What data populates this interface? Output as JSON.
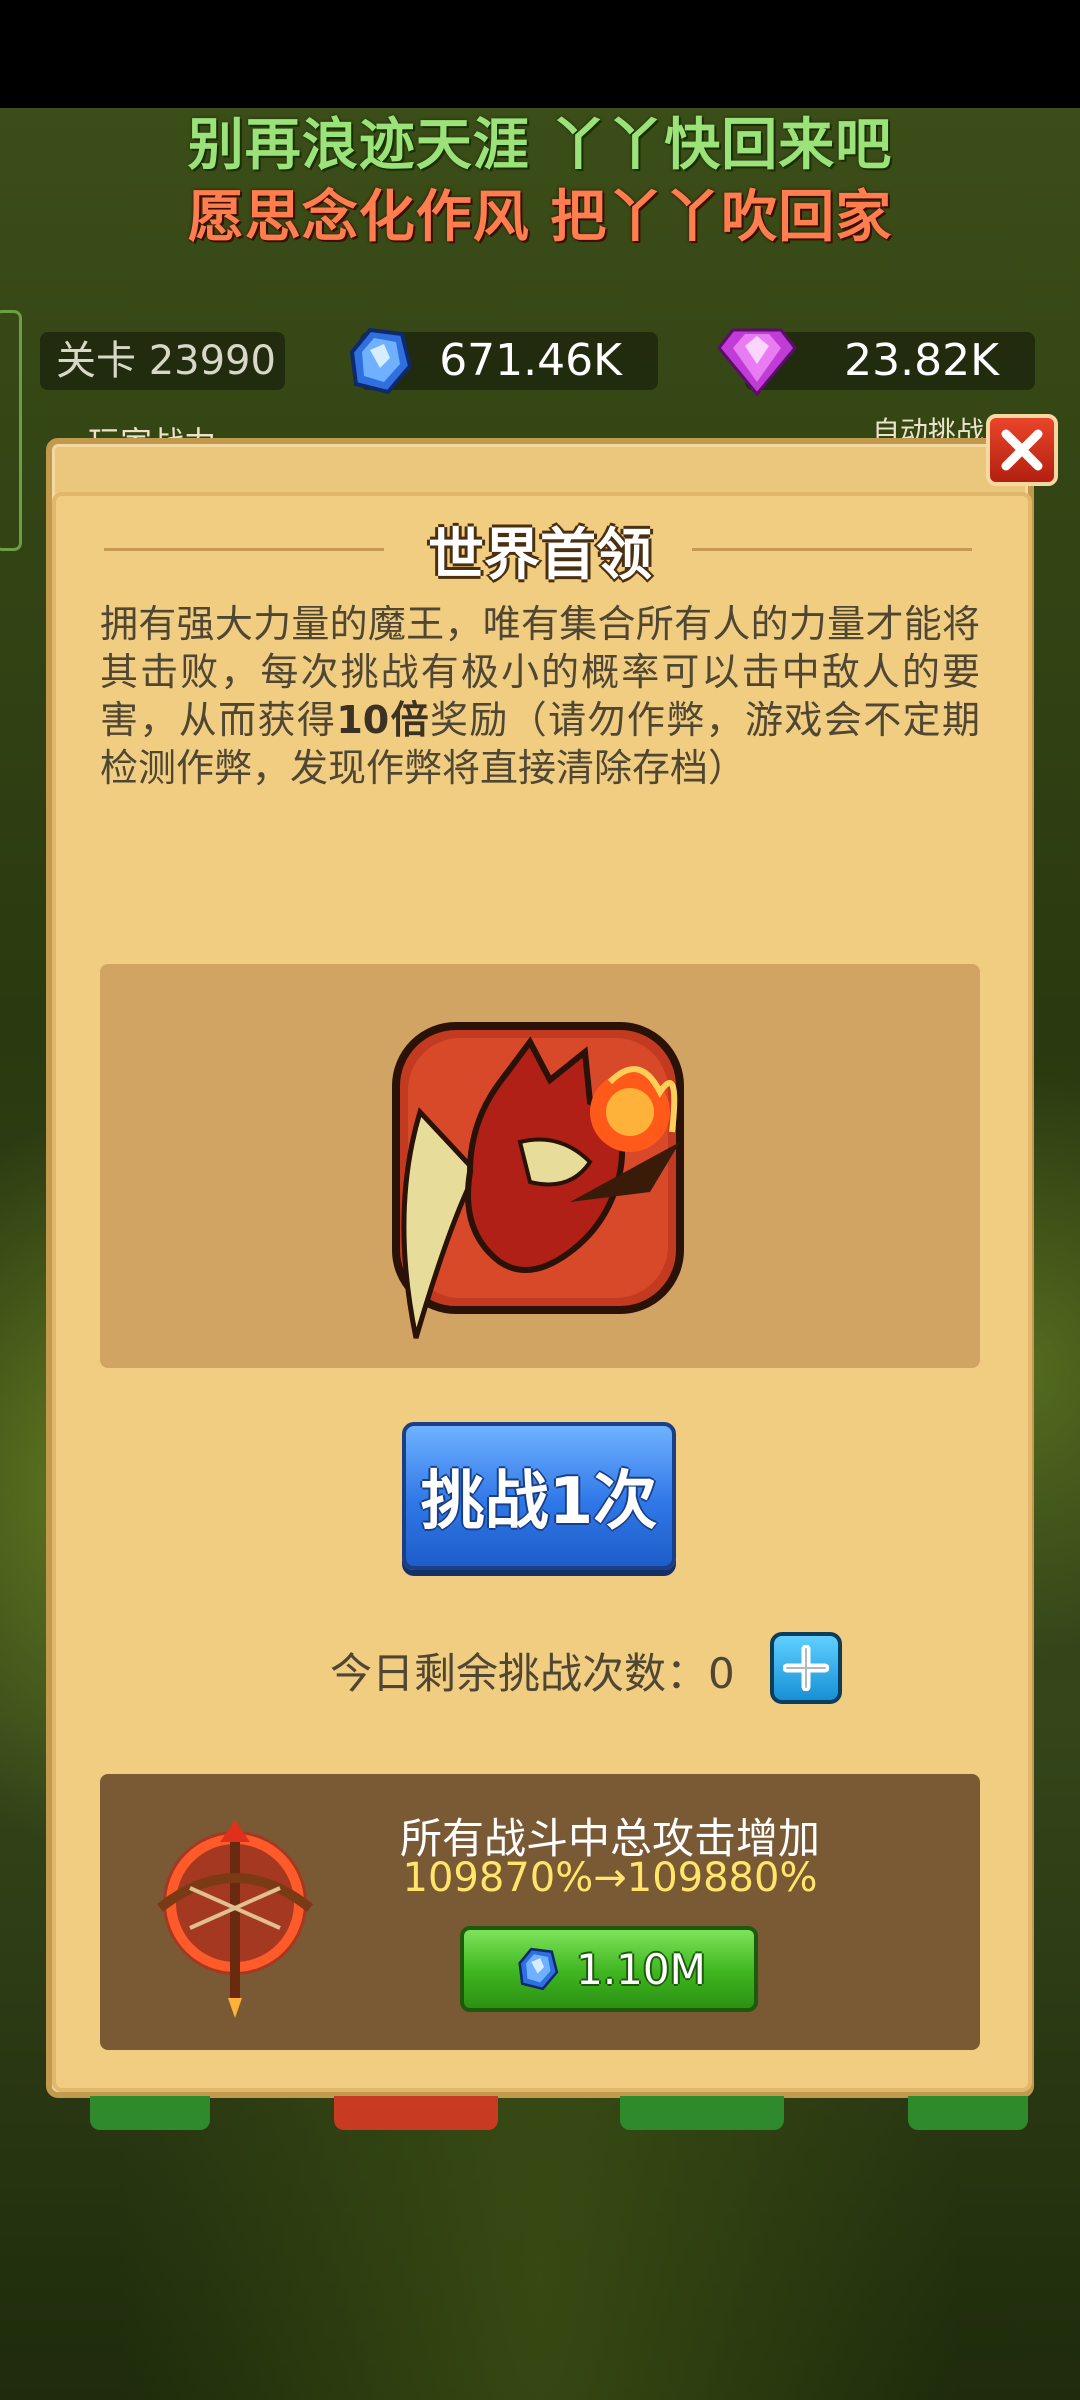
{
  "banner": {
    "line1": "别再浪迹天涯 丫丫快回来吧",
    "line2": "愿思念化作风 把丫丫吹回家"
  },
  "topbar": {
    "level_label": "关卡 23990",
    "resource1": {
      "icon": "blue-gem-icon",
      "value": "671.46K"
    },
    "resource2": {
      "icon": "purple-diamond-icon",
      "value": "23.82K"
    },
    "partial_left": "玩家战力",
    "partial_right": "自动挑战"
  },
  "dialog": {
    "title": "世界首领",
    "description_parts": {
      "before": "拥有强大力量的魔王，唯有集合所有人的力量才能将其击败，每次挑战有极小的概率可以击中敌人的要害，从而获得",
      "bold": "10倍",
      "after": "奖励（请勿作弊，游戏会不定期检测作弊，发现作弊将直接清除存档）"
    },
    "boss_icon": "red-dragon-icon",
    "challenge_button": "挑战1次",
    "remaining_label": "今日剩余挑战次数：0",
    "upgrade": {
      "icon": "crossbow-icon",
      "title": "所有战斗中总攻击增加",
      "value": "109870%→109880%",
      "cost": "1.10M"
    }
  },
  "colors": {
    "dialog_bg": "#f0cd81",
    "challenge_blue": "#2f77e8",
    "buy_green": "#3eb51f",
    "close_red": "#d23419"
  }
}
